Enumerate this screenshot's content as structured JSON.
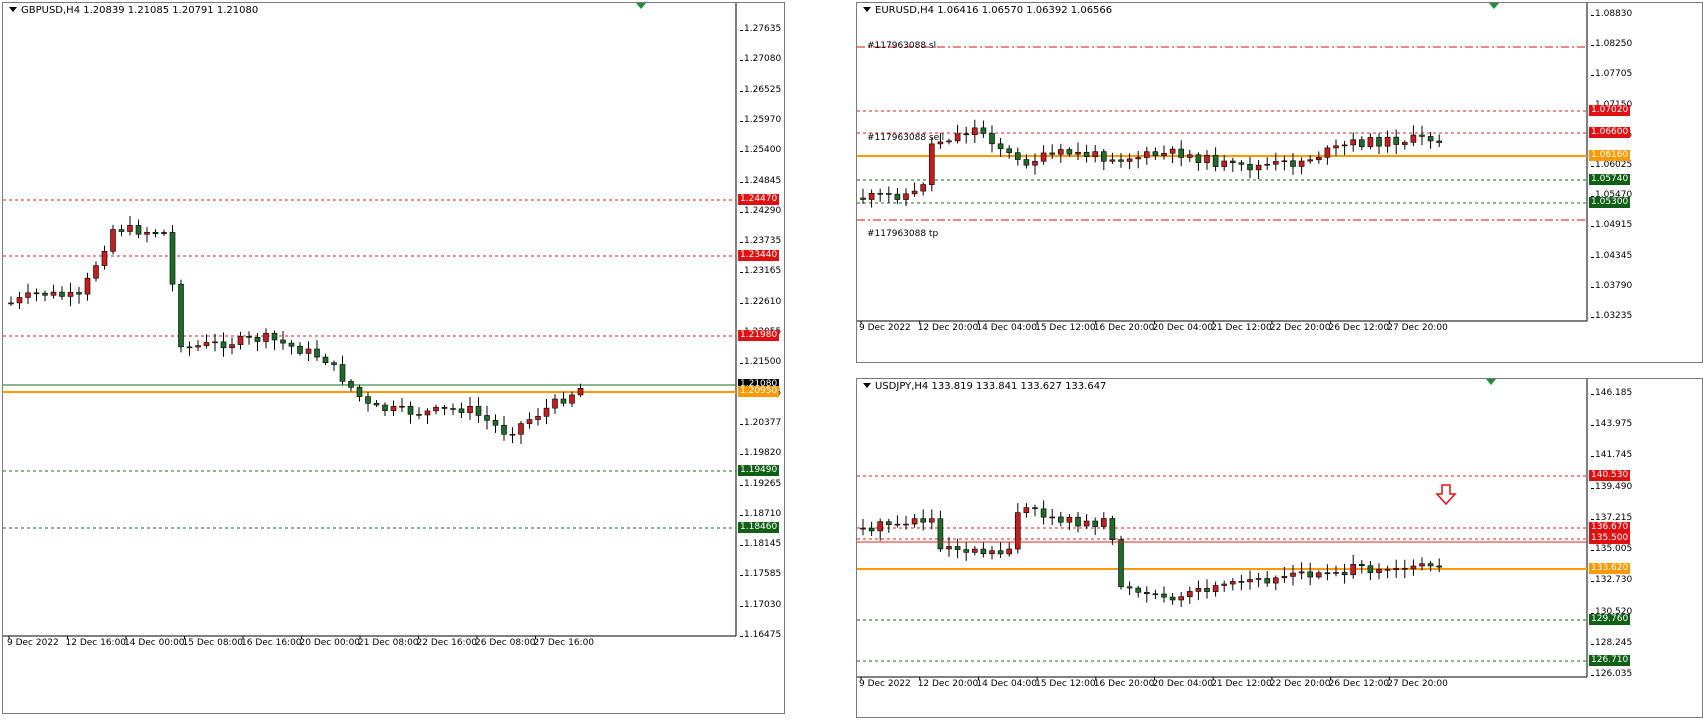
{
  "colors": {
    "bull": "#1e6b2a",
    "bear": "#c41e1e",
    "red_level": "#e02020",
    "green_level": "#1a6e1a",
    "orange": "#ff9900",
    "candle_outline": "#000000"
  },
  "charts": {
    "gbpusd": {
      "title": "GBPUSD,H4  1.20839 1.21085 1.20791 1.21080",
      "yticks": [
        "1.27635",
        "1.27080",
        "1.26525",
        "1.25970",
        "1.25400",
        "1.24845",
        "1.24290",
        "1.23735",
        "1.23165",
        "1.22610",
        "1.22055",
        "1.21500",
        "1.20945",
        "1.20377",
        "1.19820",
        "1.19265",
        "1.18710",
        "1.18145",
        "1.17585",
        "1.17030",
        "1.16475"
      ],
      "xticks": [
        "9 Dec 2022",
        "12 Dec 16:00",
        "14 Dec 00:00",
        "15 Dec 08:00",
        "16 Dec 16:00",
        "20 Dec 00:00",
        "21 Dec 08:00",
        "22 Dec 16:00",
        "26 Dec 08:00",
        "27 Dec 16:00"
      ],
      "levels": [
        {
          "label": "1.24470",
          "kind": "red"
        },
        {
          "label": "1.23440",
          "kind": "red"
        },
        {
          "label": "1.21980",
          "kind": "red"
        },
        {
          "label": "1.21080",
          "kind": "black"
        },
        {
          "label": "1.20950",
          "kind": "orange"
        },
        {
          "label": "1.19490",
          "kind": "green"
        },
        {
          "label": "1.18460",
          "kind": "green"
        }
      ]
    },
    "eurusd": {
      "title": "EURUSD,H4  1.06416 1.06570 1.06392 1.06566",
      "yticks": [
        "1.08830",
        "1.08250",
        "1.07705",
        "1.07150",
        "1.06595",
        "1.06025",
        "1.05470",
        "1.04915",
        "1.04345",
        "1.03790",
        "1.03235"
      ],
      "xticks": [
        "9 Dec 2022",
        "12 Dec 20:00",
        "14 Dec 04:00",
        "15 Dec 12:00",
        "16 Dec 20:00",
        "20 Dec 04:00",
        "21 Dec 12:00",
        "22 Dec 20:00",
        "26 Dec 12:00",
        "27 Dec 20:00"
      ],
      "levels": [
        {
          "label": "1.07020",
          "kind": "red"
        },
        {
          "label": "1.06600",
          "kind": "red"
        },
        {
          "label": "1.06160",
          "kind": "orange"
        },
        {
          "label": "1.05740",
          "kind": "green"
        },
        {
          "label": "1.05300",
          "kind": "green"
        }
      ],
      "notes": {
        "sl": "#117963088 sl",
        "sell": "#117963088 sell",
        "tp": "#117963088 tp"
      }
    },
    "usdjpy": {
      "title": "USDJPY,H4  133.819 133.841 133.627 133.647",
      "yticks": [
        "146.185",
        "143.975",
        "141.745",
        "139.490",
        "137.215",
        "135.005",
        "132.730",
        "130.520",
        "128.245",
        "126.035"
      ],
      "xticks": [
        "9 Dec 2022",
        "12 Dec 20:00",
        "14 Dec 04:00",
        "15 Dec 12:00",
        "16 Dec 20:00",
        "20 Dec 04:00",
        "21 Dec 12:00",
        "22 Dec 20:00",
        "26 Dec 12:00",
        "27 Dec 20:00"
      ],
      "levels": [
        {
          "label": "140.530",
          "kind": "red"
        },
        {
          "label": "136.670",
          "kind": "red"
        },
        {
          "label": "135.500",
          "kind": "red"
        },
        {
          "label": "133.620",
          "kind": "orange"
        },
        {
          "label": "129.760",
          "kind": "green"
        },
        {
          "label": "126.710",
          "kind": "green"
        }
      ],
      "arrow_icon": "down-arrow-icon"
    }
  }
}
